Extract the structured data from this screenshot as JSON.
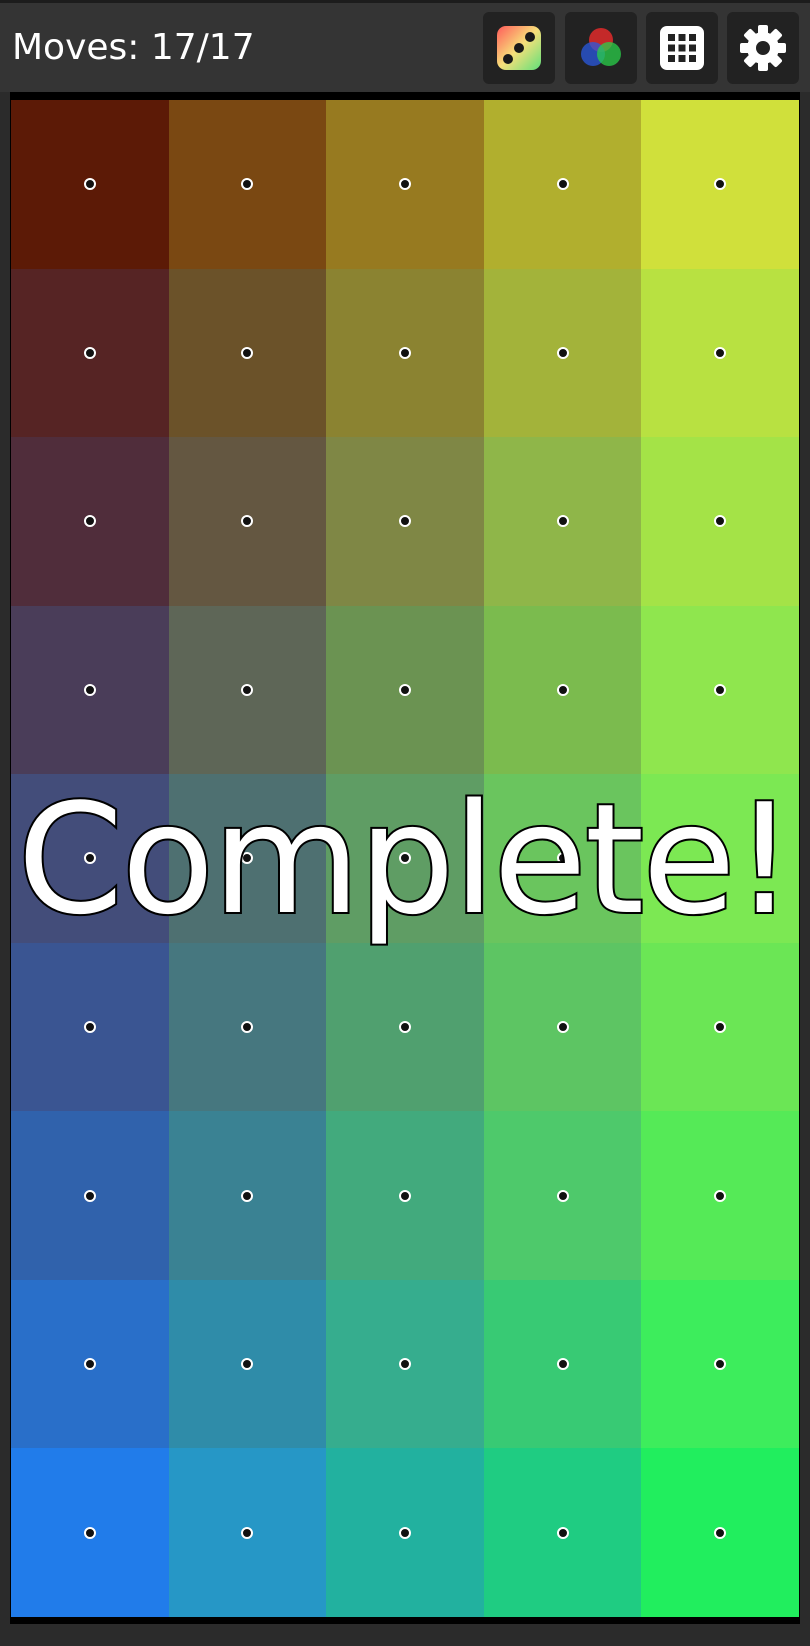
{
  "topbar": {
    "moves_label": "Moves: 17/17",
    "buttons": [
      {
        "name": "dice-button",
        "icon": "dice-icon"
      },
      {
        "name": "color-mode-button",
        "icon": "rgb-circles-icon"
      },
      {
        "name": "grid-size-button",
        "icon": "grid-icon"
      },
      {
        "name": "settings-button",
        "icon": "gear-icon"
      }
    ]
  },
  "board": {
    "columns": 5,
    "rows": 9,
    "tiles": [
      [
        "#5c1a06",
        "#7a4812",
        "#977a20",
        "#b1af2e",
        "#d0e03b"
      ],
      [
        "#562424",
        "#6b5229",
        "#8b8331",
        "#a3b33a",
        "#b8e141"
      ],
      [
        "#502d3b",
        "#645741",
        "#7f8745",
        "#8fb649",
        "#a4e347"
      ],
      [
        "#4a3d59",
        "#5e6657",
        "#6b9352",
        "#7bbb4e",
        "#8fe64e"
      ],
      [
        "#434d7a",
        "#4e7071",
        "#5f9d64",
        "#6ac55e",
        "#7ce853"
      ],
      [
        "#3a5592",
        "#46777f",
        "#50a06f",
        "#5dc563",
        "#6be655"
      ],
      [
        "#3062ac",
        "#3a8293",
        "#42aa7d",
        "#4ec96b",
        "#55ea57"
      ],
      [
        "#296fc9",
        "#2f8ca9",
        "#36ad8e",
        "#38ca74",
        "#3ded5c"
      ],
      [
        "#217cea",
        "#2697c6",
        "#22b19f",
        "#1fcc82",
        "#21ee5e"
      ]
    ]
  },
  "overlay": {
    "message": "Complete!"
  }
}
